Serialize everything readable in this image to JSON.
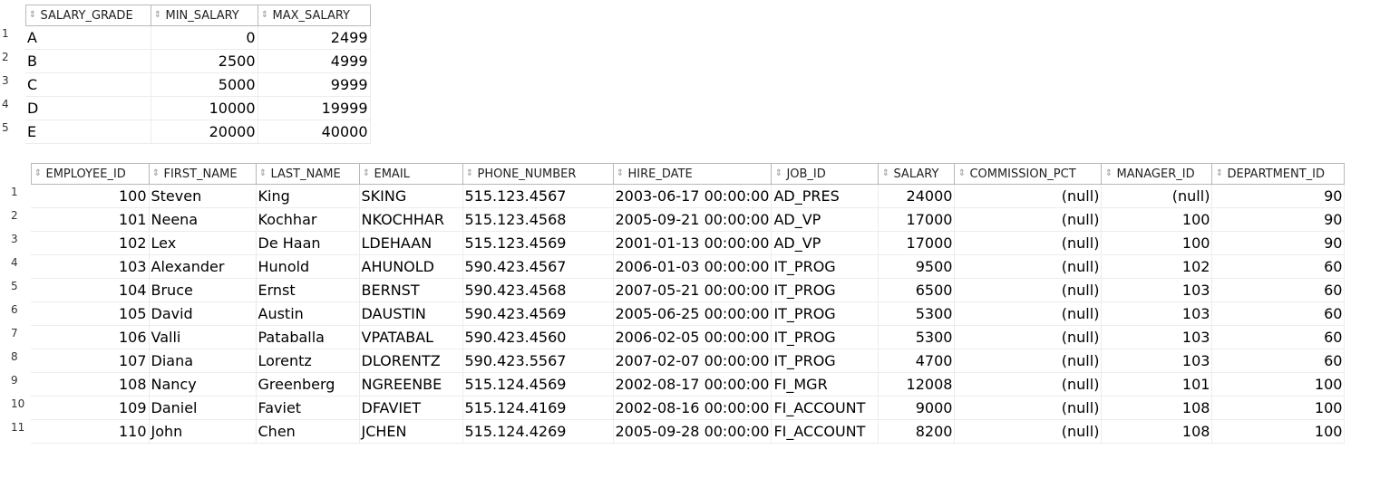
{
  "salary_grades": {
    "columns": [
      "SALARY_GRADE",
      "MIN_SALARY",
      "MAX_SALARY"
    ],
    "rows": [
      {
        "n": "1",
        "cells": [
          "A",
          "0",
          "2499"
        ]
      },
      {
        "n": "2",
        "cells": [
          "B",
          "2500",
          "4999"
        ]
      },
      {
        "n": "3",
        "cells": [
          "C",
          "5000",
          "9999"
        ]
      },
      {
        "n": "4",
        "cells": [
          "D",
          "10000",
          "19999"
        ]
      },
      {
        "n": "5",
        "cells": [
          "E",
          "20000",
          "40000"
        ]
      }
    ]
  },
  "employees": {
    "columns": [
      "EMPLOYEE_ID",
      "FIRST_NAME",
      "LAST_NAME",
      "EMAIL",
      "PHONE_NUMBER",
      "HIRE_DATE",
      "JOB_ID",
      "SALARY",
      "COMMISSION_PCT",
      "MANAGER_ID",
      "DEPARTMENT_ID"
    ],
    "rows": [
      {
        "n": "1",
        "cells": [
          "100",
          "Steven",
          "King",
          "SKING",
          "515.123.4567",
          "2003-06-17 00:00:00",
          "AD_PRES",
          "24000",
          "(null)",
          "(null)",
          "90"
        ]
      },
      {
        "n": "2",
        "cells": [
          "101",
          "Neena",
          "Kochhar",
          "NKOCHHAR",
          "515.123.4568",
          "2005-09-21 00:00:00",
          "AD_VP",
          "17000",
          "(null)",
          "100",
          "90"
        ]
      },
      {
        "n": "3",
        "cells": [
          "102",
          "Lex",
          "De Haan",
          "LDEHAAN",
          "515.123.4569",
          "2001-01-13 00:00:00",
          "AD_VP",
          "17000",
          "(null)",
          "100",
          "90"
        ]
      },
      {
        "n": "4",
        "cells": [
          "103",
          "Alexander",
          "Hunold",
          "AHUNOLD",
          "590.423.4567",
          "2006-01-03 00:00:00",
          "IT_PROG",
          "9500",
          "(null)",
          "102",
          "60"
        ]
      },
      {
        "n": "5",
        "cells": [
          "104",
          "Bruce",
          "Ernst",
          "BERNST",
          "590.423.4568",
          "2007-05-21 00:00:00",
          "IT_PROG",
          "6500",
          "(null)",
          "103",
          "60"
        ]
      },
      {
        "n": "6",
        "cells": [
          "105",
          "David",
          "Austin",
          "DAUSTIN",
          "590.423.4569",
          "2005-06-25 00:00:00",
          "IT_PROG",
          "5300",
          "(null)",
          "103",
          "60"
        ]
      },
      {
        "n": "7",
        "cells": [
          "106",
          "Valli",
          "Pataballa",
          "VPATABAL",
          "590.423.4560",
          "2006-02-05 00:00:00",
          "IT_PROG",
          "5300",
          "(null)",
          "103",
          "60"
        ]
      },
      {
        "n": "8",
        "cells": [
          "107",
          "Diana",
          "Lorentz",
          "DLORENTZ",
          "590.423.5567",
          "2007-02-07 00:00:00",
          "IT_PROG",
          "4700",
          "(null)",
          "103",
          "60"
        ]
      },
      {
        "n": "9",
        "cells": [
          "108",
          "Nancy",
          "Greenberg",
          "NGREENBE",
          "515.124.4569",
          "2002-08-17 00:00:00",
          "FI_MGR",
          "12008",
          "(null)",
          "101",
          "100"
        ]
      },
      {
        "n": "10",
        "cells": [
          "109",
          "Daniel",
          "Faviet",
          "DFAVIET",
          "515.124.4169",
          "2002-08-16 00:00:00",
          "FI_ACCOUNT",
          "9000",
          "(null)",
          "108",
          "100"
        ]
      },
      {
        "n": "11",
        "cells": [
          "110",
          "John",
          "Chen",
          "JCHEN",
          "515.124.4269",
          "2005-09-28 00:00:00",
          "FI_ACCOUNT",
          "8200",
          "(null)",
          "108",
          "100"
        ]
      }
    ]
  },
  "icons": {
    "sort": "sort-arrows-icon"
  }
}
